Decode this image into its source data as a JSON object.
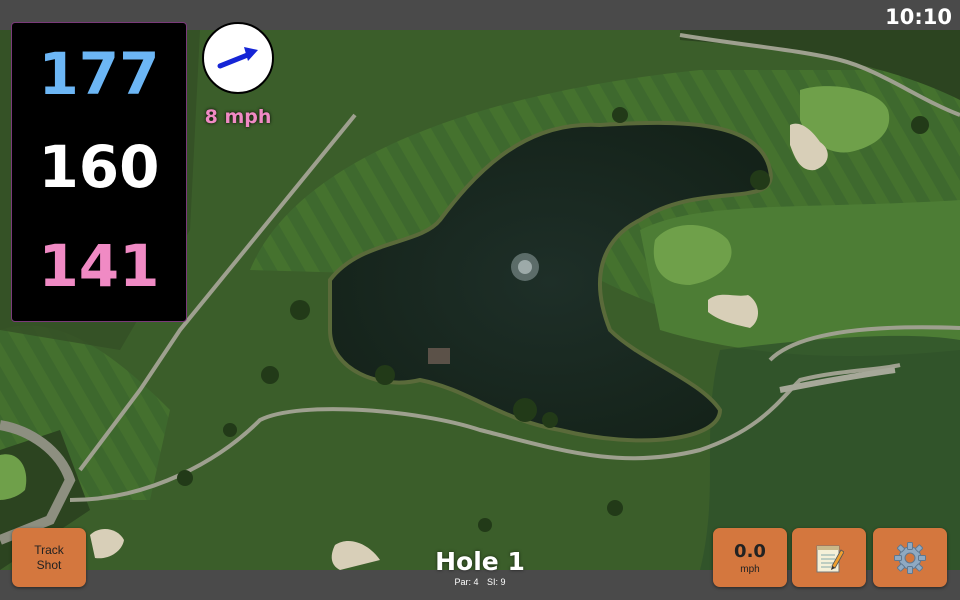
{
  "status": {
    "time": "10:10"
  },
  "distances": {
    "back": "177",
    "middle": "160",
    "front": "141",
    "colors": {
      "back": "#6cb6f5",
      "middle": "#ffffff",
      "front": "#f08ac4"
    }
  },
  "wind": {
    "speed": "8 mph",
    "direction_icon": "arrow-icon",
    "color": "#f08ac4",
    "arrow_color": "#1525d6"
  },
  "buttons": {
    "track_shot": {
      "line1": "Track",
      "line2": "Shot"
    },
    "speed": {
      "value": "0.0",
      "unit": "mph"
    },
    "notes": {
      "icon": "notepad-icon"
    },
    "settings": {
      "icon": "gear-icon"
    }
  },
  "hole": {
    "title": "Hole 1",
    "par": "Par: 4",
    "si": "SI: 9"
  },
  "colors": {
    "accent": "#d4773e",
    "bar": "#4a4a4a"
  }
}
